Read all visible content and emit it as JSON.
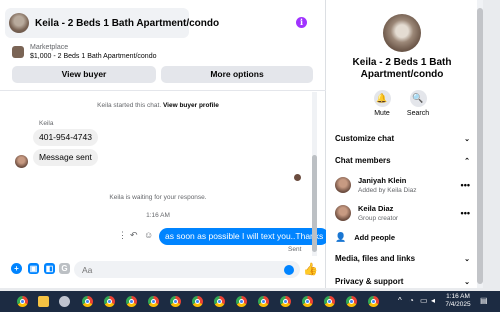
{
  "chat": {
    "title": "Keila - 2 Beds 1 Bath Apartment/condo",
    "listing_label": "Marketplace",
    "listing_name": "$1,000 - 2 Beds 1 Bath Apartment/condo",
    "view_buyer_label": "View buyer",
    "more_options_label": "More options",
    "started_text": "Keila started this chat.",
    "view_buyer_profile_label": "View buyer profile",
    "sender_name": "Keila",
    "messages": [
      "401-954-4743",
      "Message sent"
    ],
    "waiting_text": "Keila is waiting for your response.",
    "timestamp": "1:16 AM",
    "outgoing_message": "as soon as possible I will text you..Thanks",
    "sent_status": "Sent",
    "input_placeholder": "Aa"
  },
  "side": {
    "title": "Keila - 2 Beds 1 Bath Apartment/condo",
    "actions": [
      {
        "label": "Mute",
        "icon": "bell-icon"
      },
      {
        "label": "Search",
        "icon": "search-icon"
      }
    ],
    "customize_label": "Customize chat",
    "members_label": "Chat members",
    "members": [
      {
        "name": "Janiyah Klein",
        "sub": "Added by Keila Diaz"
      },
      {
        "name": "Keila Diaz",
        "sub": "Group creator"
      }
    ],
    "add_people_label": "Add people",
    "media_label": "Media, files and links",
    "privacy_label": "Privacy & support"
  },
  "taskbar": {
    "time": "1:16 AM",
    "date": "7/4/2025"
  },
  "colors": {
    "accent": "#0084ff",
    "info_purple": "#a033ff",
    "taskbar": "#1c2b42"
  }
}
